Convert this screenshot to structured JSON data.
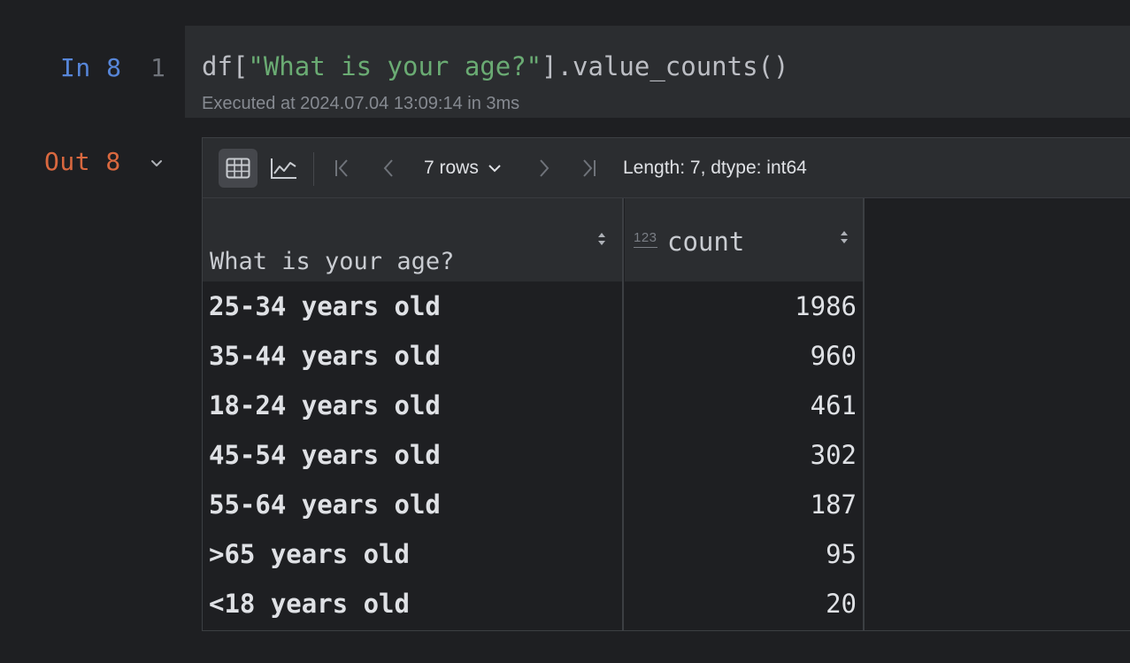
{
  "input_cell": {
    "prompt": "In 8",
    "line_number": "1",
    "code_prefix": "df[",
    "code_string": "\"What is your age?\"",
    "code_suffix": "].value_counts()",
    "executed_meta": "Executed at 2024.07.04 13:09:14 in 3ms"
  },
  "output_cell": {
    "prompt": "Out 8",
    "toolbar": {
      "table_view_icon": "table-grid-icon",
      "chart_view_icon": "line-chart-icon",
      "rows_label": "7 rows",
      "length_info": "Length: 7, dtype: int64"
    },
    "table": {
      "index_header": "What is your age?",
      "value_header": "count",
      "value_type_badge": "123",
      "rows": [
        {
          "label": "25-34 years old",
          "count": "1986"
        },
        {
          "label": "35-44 years old",
          "count": "960"
        },
        {
          "label": "18-24 years old",
          "count": "461"
        },
        {
          "label": "45-54 years old",
          "count": "302"
        },
        {
          "label": "55-64 years old",
          "count": "187"
        },
        {
          "label": ">65 years old",
          "count": "95"
        },
        {
          "label": "<18 years old",
          "count": "20"
        }
      ]
    }
  },
  "colors": {
    "background": "#1e1f22",
    "panel": "#2b2d30",
    "in_prompt": "#5786d9",
    "out_prompt": "#d9683f",
    "string_literal": "#6aab73"
  }
}
